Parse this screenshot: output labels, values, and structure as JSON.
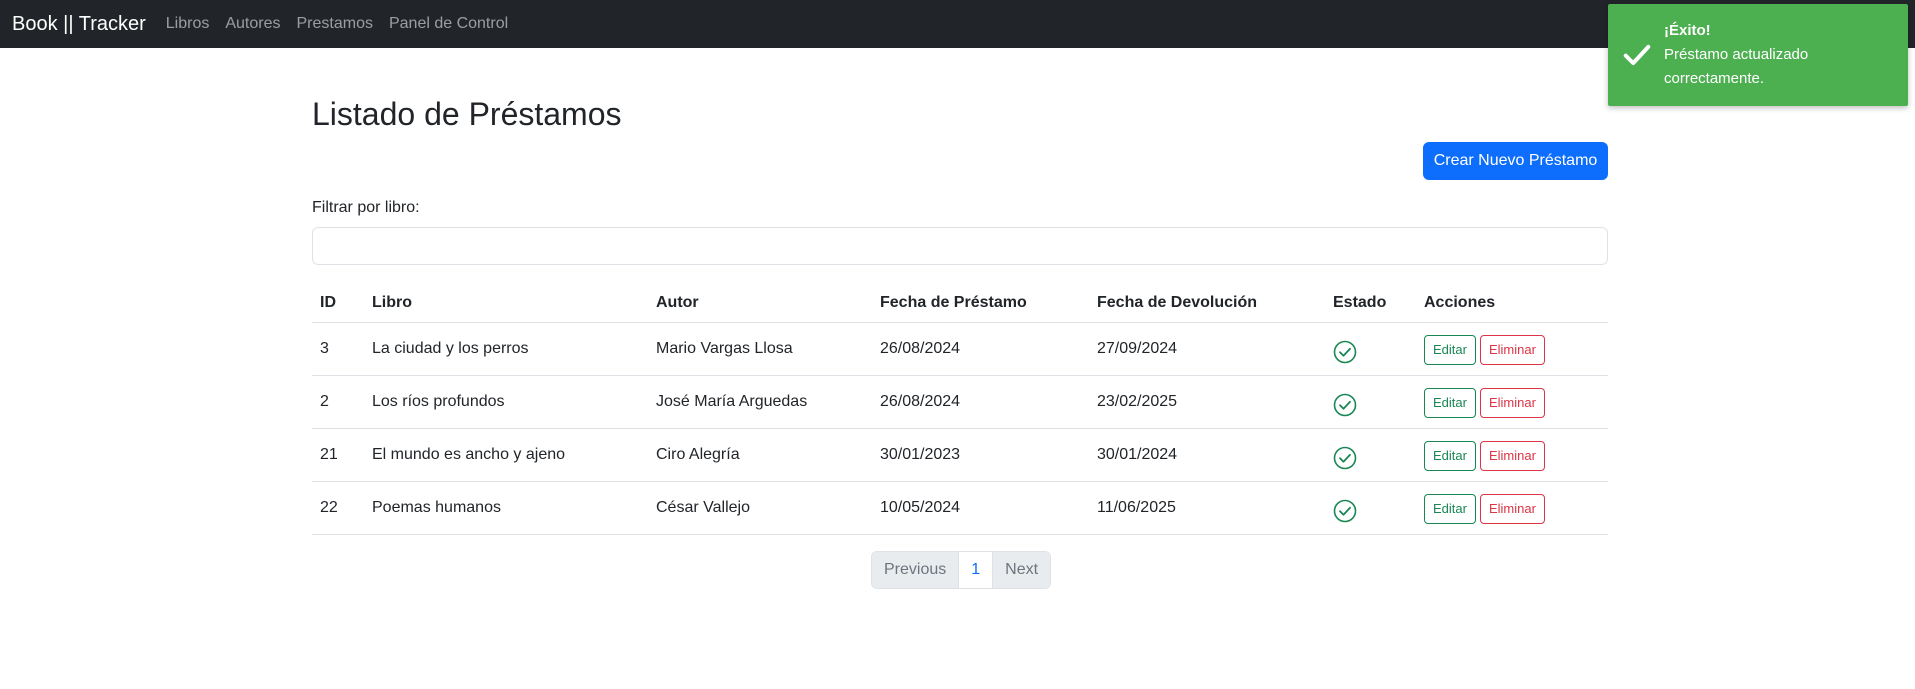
{
  "navbar": {
    "brand": "Book || Tracker",
    "links": [
      "Libros",
      "Autores",
      "Prestamos",
      "Panel de Control"
    ]
  },
  "toast": {
    "title": "¡Éxito!",
    "message": "Préstamo actualizado correctamente.",
    "icon": "check-icon",
    "color": "#4caf50"
  },
  "main": {
    "title": "Listado de Préstamos",
    "create_button": "Crear Nuevo Préstamo",
    "filter_label": "Filtrar por libro:",
    "filter_value": "",
    "filter_placeholder": ""
  },
  "table": {
    "headers": [
      "ID",
      "Libro",
      "Autor",
      "Fecha de Préstamo",
      "Fecha de Devolución",
      "Estado",
      "Acciones"
    ],
    "rows": [
      {
        "id": "3",
        "libro": "La ciudad y los perros",
        "autor": "Mario Vargas Llosa",
        "fecha_prestamo": "26/08/2024",
        "fecha_devolucion": "27/09/2024",
        "estado_icon": "check-circle-icon"
      },
      {
        "id": "2",
        "libro": "Los ríos profundos",
        "autor": "José María Arguedas",
        "fecha_prestamo": "26/08/2024",
        "fecha_devolucion": "23/02/2025",
        "estado_icon": "check-circle-icon"
      },
      {
        "id": "21",
        "libro": "El mundo es ancho y ajeno",
        "autor": "Ciro Alegría",
        "fecha_prestamo": "30/01/2023",
        "fecha_devolucion": "30/01/2024",
        "estado_icon": "check-circle-icon"
      },
      {
        "id": "22",
        "libro": "Poemas humanos",
        "autor": "César Vallejo",
        "fecha_prestamo": "10/05/2024",
        "fecha_devolucion": "11/06/2025",
        "estado_icon": "check-circle-icon"
      }
    ],
    "edit_label": "Editar",
    "delete_label": "Eliminar"
  },
  "pagination": {
    "previous": "Previous",
    "current": "1",
    "next": "Next"
  },
  "colors": {
    "navbar": "#212529",
    "primary": "#0d6efd",
    "success": "#198754",
    "danger": "#dc3545"
  }
}
